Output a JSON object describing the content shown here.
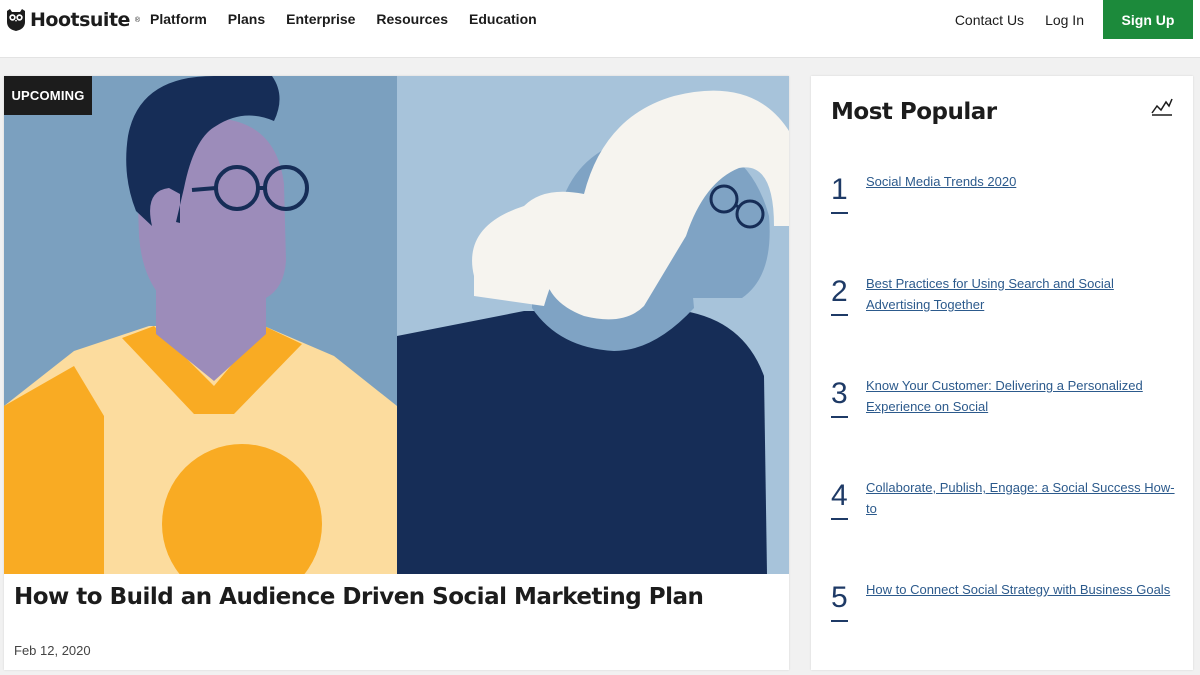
{
  "header": {
    "logo_text": "Hootsuite",
    "logo_reg": "®",
    "nav": [
      {
        "label": "Platform"
      },
      {
        "label": "Plans"
      },
      {
        "label": "Enterprise"
      },
      {
        "label": "Resources"
      },
      {
        "label": "Education"
      }
    ],
    "contact_label": "Contact Us",
    "login_label": "Log In",
    "signup_label": "Sign Up"
  },
  "featured": {
    "badge": "UPCOMING",
    "title": "How to Build an Audience Driven Social Marketing Plan",
    "date": "Feb 12, 2020",
    "image_icon": "illustration-two-people-with-glasses"
  },
  "most_popular": {
    "title": "Most Popular",
    "icon": "trend-line-icon",
    "items": [
      {
        "number": "1",
        "title": "Social Media Trends 2020"
      },
      {
        "number": "2",
        "title": "Best Practices for Using Search and Social Advertising Together"
      },
      {
        "number": "3",
        "title": "Know Your Customer: Delivering a Personalized Experience on Social"
      },
      {
        "number": "4",
        "title": "Collaborate, Publish, Engage: a Social Success How-to"
      },
      {
        "number": "5",
        "title": "How to Connect Social Strategy with Business Goals"
      }
    ]
  },
  "colors": {
    "signup_green": "#1c8a3b",
    "link_blue": "#2c5a8c",
    "number_navy": "#1e3a66"
  }
}
